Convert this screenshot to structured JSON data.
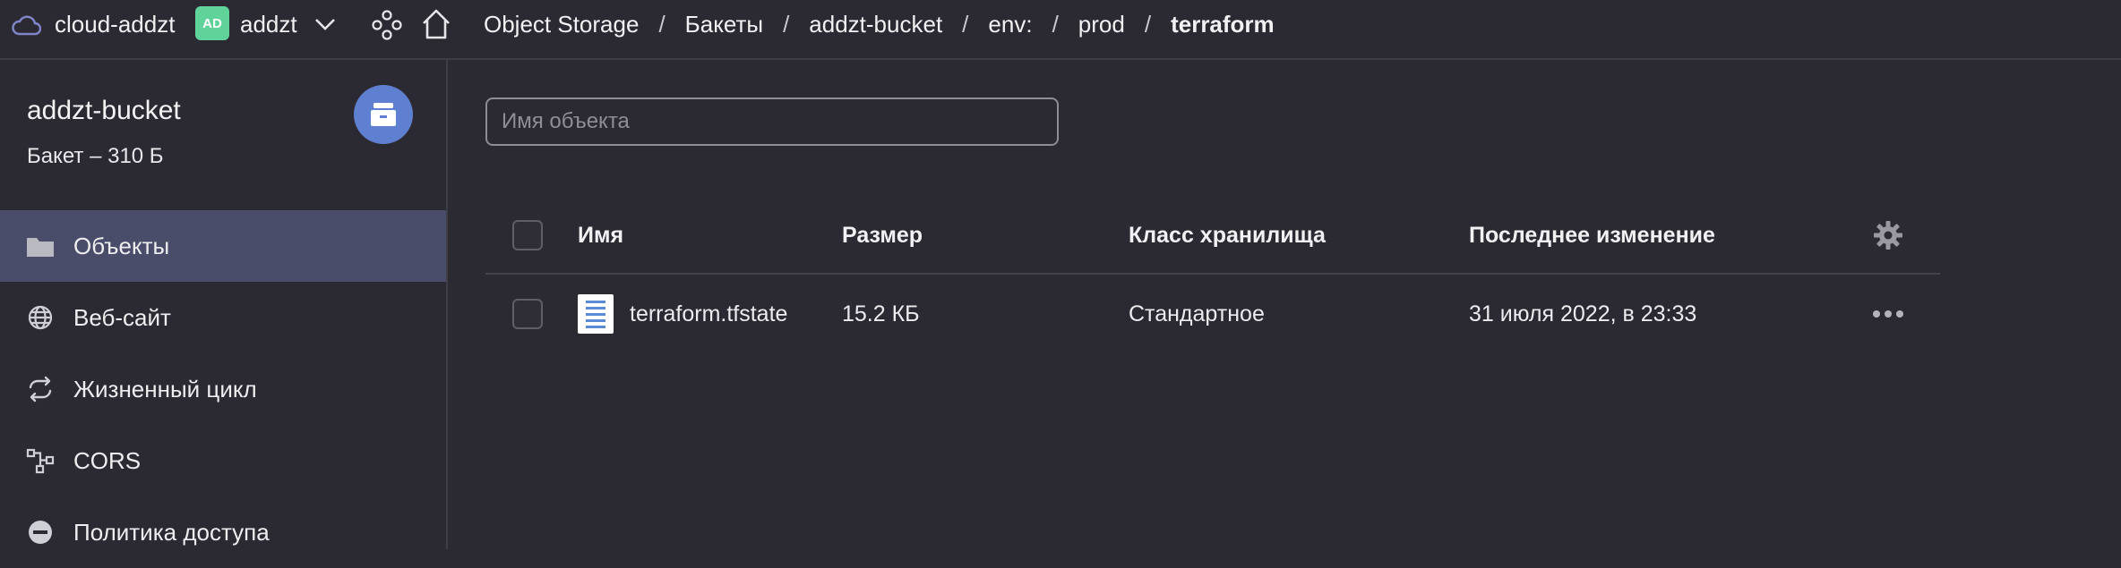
{
  "topbar": {
    "cloud_label": "cloud-addzt",
    "avatar_initials": "AD",
    "user_label": "addzt",
    "breadcrumbs": [
      "Object Storage",
      "Бакеты",
      "addzt-bucket",
      "env:",
      "prod",
      "terraform"
    ],
    "separator": "/"
  },
  "sidebar": {
    "bucket_name": "addzt-bucket",
    "bucket_subtitle": "Бакет – 310 Б",
    "items": [
      {
        "label": "Объекты",
        "icon": "folder-icon",
        "active": true
      },
      {
        "label": "Веб-сайт",
        "icon": "globe-icon",
        "active": false
      },
      {
        "label": "Жизненный цикл",
        "icon": "cycle-icon",
        "active": false
      },
      {
        "label": "CORS",
        "icon": "cors-icon",
        "active": false
      },
      {
        "label": "Политика доступа",
        "icon": "policy-icon",
        "active": false
      }
    ]
  },
  "main": {
    "search_placeholder": "Имя объекта",
    "columns": [
      "Имя",
      "Размер",
      "Класс хранилища",
      "Последнее изменение"
    ],
    "rows": [
      {
        "name": "terraform.tfstate",
        "size": "15.2 КБ",
        "storage_class": "Стандартное",
        "modified": "31 июля 2022, в 23:33"
      }
    ]
  },
  "colors": {
    "background": "#2b2a33",
    "active_nav": "#4a4d6a",
    "avatar": "#5fd39a",
    "bucket_badge": "#5f7fd0"
  }
}
